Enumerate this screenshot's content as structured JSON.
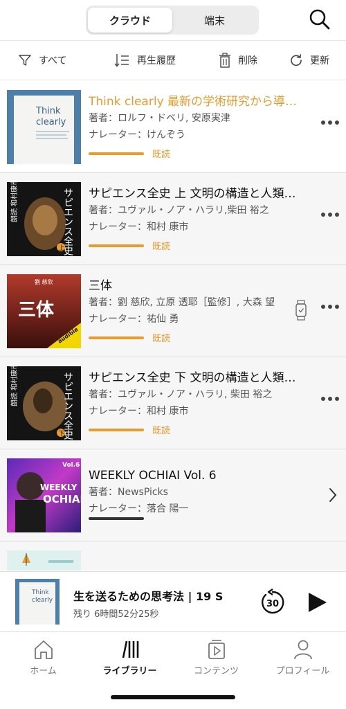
{
  "header": {
    "segments": [
      "クラウド",
      "端末"
    ],
    "active_segment": "クラウド"
  },
  "toolbar": {
    "filter_label": "すべて",
    "history_label": "再生履歴",
    "delete_label": "削除",
    "refresh_label": "更新"
  },
  "books": [
    {
      "title": "Think clearly 最新の学術研究から導いた、よりよい人生を送るための思考法",
      "author": "著者：ロルフ・ドベリ, 安原実津",
      "narrator": "ナレーター：けんぞう",
      "status": "既読",
      "cover_text": [
        "Think",
        "clearly"
      ],
      "accent": true,
      "action_icon": "more-icon"
    },
    {
      "title": "サピエンス全史 上 文明の構造と人類の幸福",
      "author": "著者：ユヴァル・ノア・ハラリ,柴田 裕之",
      "narrator": "ナレーター：和村 康市",
      "status": "既読",
      "cover_text": [
        "サピエンス全史",
        "上",
        "朗読 和村康市"
      ],
      "accent": false,
      "action_icon": "more-icon"
    },
    {
      "title": "三体",
      "author": "著者：劉 慈欣, 立原 透耶［監修］, 大森 望",
      "narrator": "ナレーター：祐仙 勇",
      "status": "既読",
      "cover_text": [
        "劉 慈欣",
        "三体",
        "audible"
      ],
      "accent": false,
      "action_icon": "more-icon"
    },
    {
      "title": "サピエンス全史 下 文明の構造と人類の幸福",
      "author": "著者：ユヴァル・ノア・ハラリ, 柴田 裕之",
      "narrator": "ナレーター：和村 康市",
      "status": "既読",
      "cover_text": [
        "サピエンス全史",
        "下",
        "朗読 和村康市"
      ],
      "accent": false,
      "action_icon": "more-icon"
    },
    {
      "title": "WEEKLY OCHIAI Vol. 6",
      "author": "著者：NewsPicks",
      "narrator": "ナレーター：落合 陽一",
      "status": "",
      "cover_text": [
        "Vol.6",
        "WEEKLY",
        "OCHIAI"
      ],
      "accent": false,
      "action_icon": "chevron-right-icon"
    }
  ],
  "player": {
    "title": "生を送るための思考法 | 19 S",
    "remaining": "残り 6時間52分25秒",
    "skip_seconds": "30",
    "cover_text": [
      "Think",
      "clearly"
    ]
  },
  "tabs": [
    {
      "label": "ホーム",
      "icon": "home-icon"
    },
    {
      "label": "ライブラリー",
      "icon": "library-icon"
    },
    {
      "label": "コンテンツ",
      "icon": "contents-icon"
    },
    {
      "label": "プロフィール",
      "icon": "profile-icon"
    }
  ],
  "active_tab": "ライブラリー",
  "colors": {
    "accent": "#e89b2f",
    "text": "#1a1a1a",
    "background": "#f6f6f6"
  }
}
